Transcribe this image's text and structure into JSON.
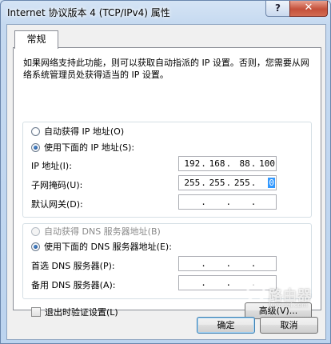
{
  "window": {
    "title": "Internet 协议版本 4 (TCP/IPv4) 属性",
    "help_label": "?",
    "close_label": "✕"
  },
  "tab": {
    "label": "常规"
  },
  "description": "如果网络支持此功能，则可以获取自动指派的 IP 设置。否则，您需要从网络系统管理员处获得适当的 IP 设置。",
  "ip_section": {
    "auto_label": "自动获得 IP 地址(O)",
    "manual_label": "使用下面的 IP 地址(S):",
    "ip_label": "IP 地址(I):",
    "ip_value": [
      "192",
      "168",
      "88",
      "100"
    ],
    "subnet_label": "子网掩码(U):",
    "subnet_value": [
      "255",
      "255",
      "255",
      "0"
    ],
    "gateway_label": "默认网关(D):",
    "gateway_value": [
      "",
      "",
      "",
      ""
    ]
  },
  "dns_section": {
    "auto_label": "自动获得 DNS 服务器地址(B)",
    "manual_label": "使用下面的 DNS 服务器地址(E):",
    "preferred_label": "首选 DNS 服务器(P):",
    "alternate_label": "备用 DNS 服务器(A):"
  },
  "validate_label": "退出时验证设置(L)",
  "advanced_label": "高级(V)...",
  "ok_label": "确定",
  "cancel_label": "取消",
  "watermark": {
    "text": "路由器",
    "url": "luyouqi.com"
  }
}
